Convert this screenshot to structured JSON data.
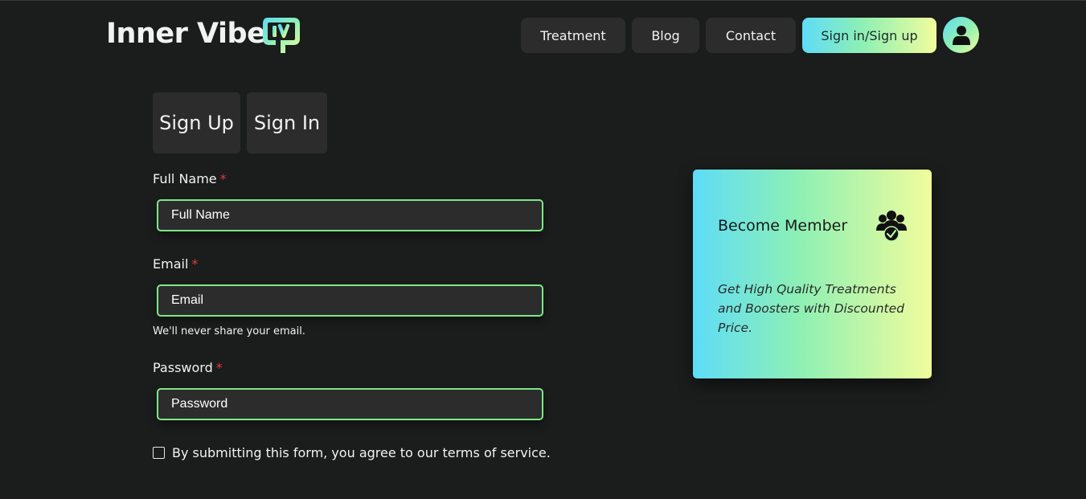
{
  "brand": {
    "name": "Inner Vibe",
    "logo_icon": "iv-logo-icon"
  },
  "nav": {
    "treatment": "Treatment",
    "blog": "Blog",
    "contact": "Contact",
    "signin": "Sign in/Sign up",
    "avatar_icon": "user-icon"
  },
  "tabs": {
    "signup": "Sign Up",
    "signin": "Sign In"
  },
  "form": {
    "full_name": {
      "label": "Full Name",
      "required": "*",
      "placeholder": "Full Name",
      "value": ""
    },
    "email": {
      "label": "Email",
      "required": "*",
      "placeholder": "Email",
      "value": "",
      "help": "We'll never share your email."
    },
    "password": {
      "label": "Password",
      "required": "*",
      "placeholder": "Password",
      "value": ""
    },
    "terms": {
      "text": "By submitting this form, you agree to our terms of service.",
      "checked": false
    }
  },
  "member_card": {
    "title": "Become Member",
    "icon": "members-group-icon",
    "text": "Get High Quality Treatments and Boosters with Discounted Price."
  },
  "colors": {
    "background": "#1b1c1c",
    "surface": "#2c2c2d",
    "input_border": "#7de88a",
    "required": "#e03a3a",
    "gradient_start": "#5edcf7",
    "gradient_mid": "#8ef0b4",
    "gradient_end": "#f1fc9c"
  }
}
